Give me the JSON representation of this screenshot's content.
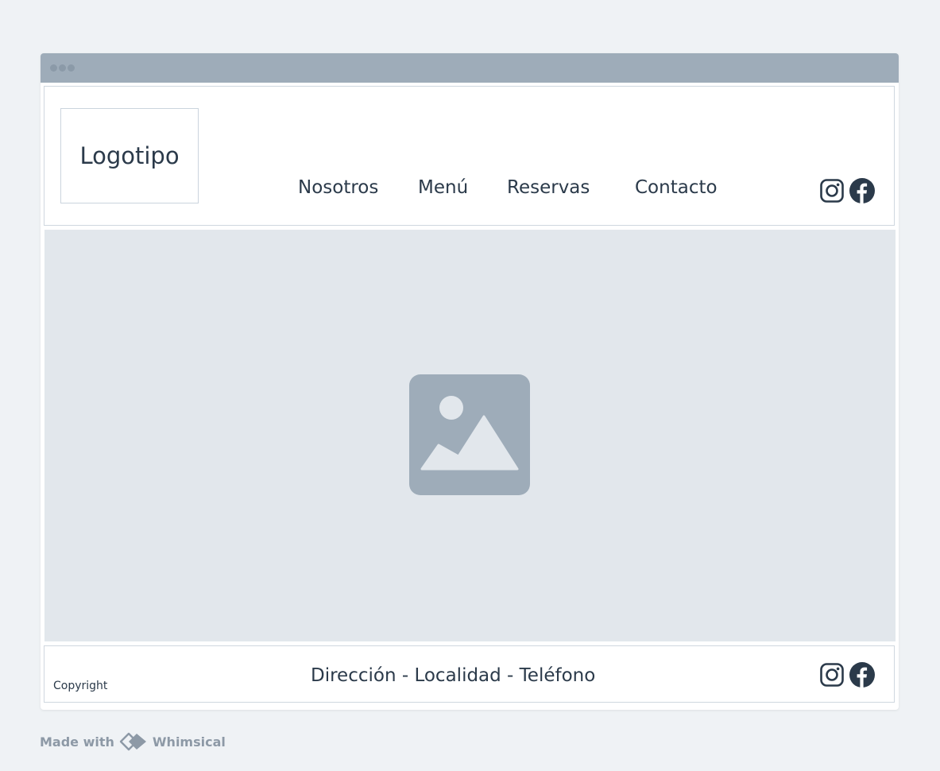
{
  "header": {
    "logo_text": "Logotipo",
    "nav": [
      "Nosotros",
      "Menú",
      "Reservas",
      "Contacto"
    ],
    "social_icons": [
      "instagram-icon",
      "facebook-icon"
    ]
  },
  "hero": {
    "placeholder_icon": "image-placeholder-icon"
  },
  "footer": {
    "copyright": "Copyright",
    "address": "Dirección - Localidad - Teléfono",
    "social_icons": [
      "instagram-icon",
      "facebook-icon"
    ]
  },
  "watermark": {
    "made_with": "Made with",
    "brand": "Whimsical"
  },
  "colors": {
    "background": "#eff2f5",
    "titlebar": "#9eacb9",
    "hero": "#e2e7ec",
    "placeholder": "#9eacb9",
    "text": "#2b3a4a"
  }
}
